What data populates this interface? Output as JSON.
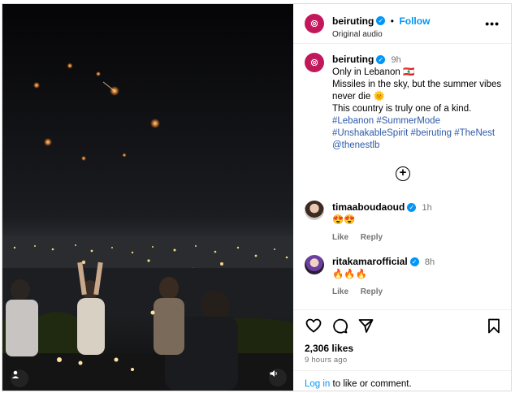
{
  "post": {
    "author": "beiruting",
    "follow_label": "Follow",
    "audio": "Original audio",
    "more": "•••"
  },
  "caption": {
    "author": "beiruting",
    "time": "9h",
    "line1": "Only in Lebanon 🇱🇧",
    "line2": "Missiles in the sky, but the summer vibes",
    "line3": "never die 🌞",
    "line4": "This country is truly one of a kind.",
    "tags1": "#Lebanon #SummerMode",
    "tags2": "#UnshakableSpirit #beiruting #TheNest",
    "tags3": "@thenestlb"
  },
  "comments": [
    {
      "user": "timaaboudaoud",
      "time": "1h",
      "text": "😍😍",
      "like": "Like",
      "reply": "Reply"
    },
    {
      "user": "ritakamarofficial",
      "time": "8h",
      "text": "🔥🔥🔥",
      "like": "Like",
      "reply": "Reply"
    }
  ],
  "stats": {
    "likes": "2,306 likes",
    "posted": "9 hours ago"
  },
  "login": {
    "link": "Log in",
    "rest": " to like or comment."
  },
  "icons": [
    "heart-icon",
    "comment-icon",
    "share-icon",
    "bookmark-icon",
    "user-tag-icon",
    "speaker-icon",
    "add-circle-icon",
    "verified-icon"
  ],
  "colors": {
    "accent": "#0095f6",
    "hashtag": "#2d5aa8",
    "muted": "#737373"
  }
}
